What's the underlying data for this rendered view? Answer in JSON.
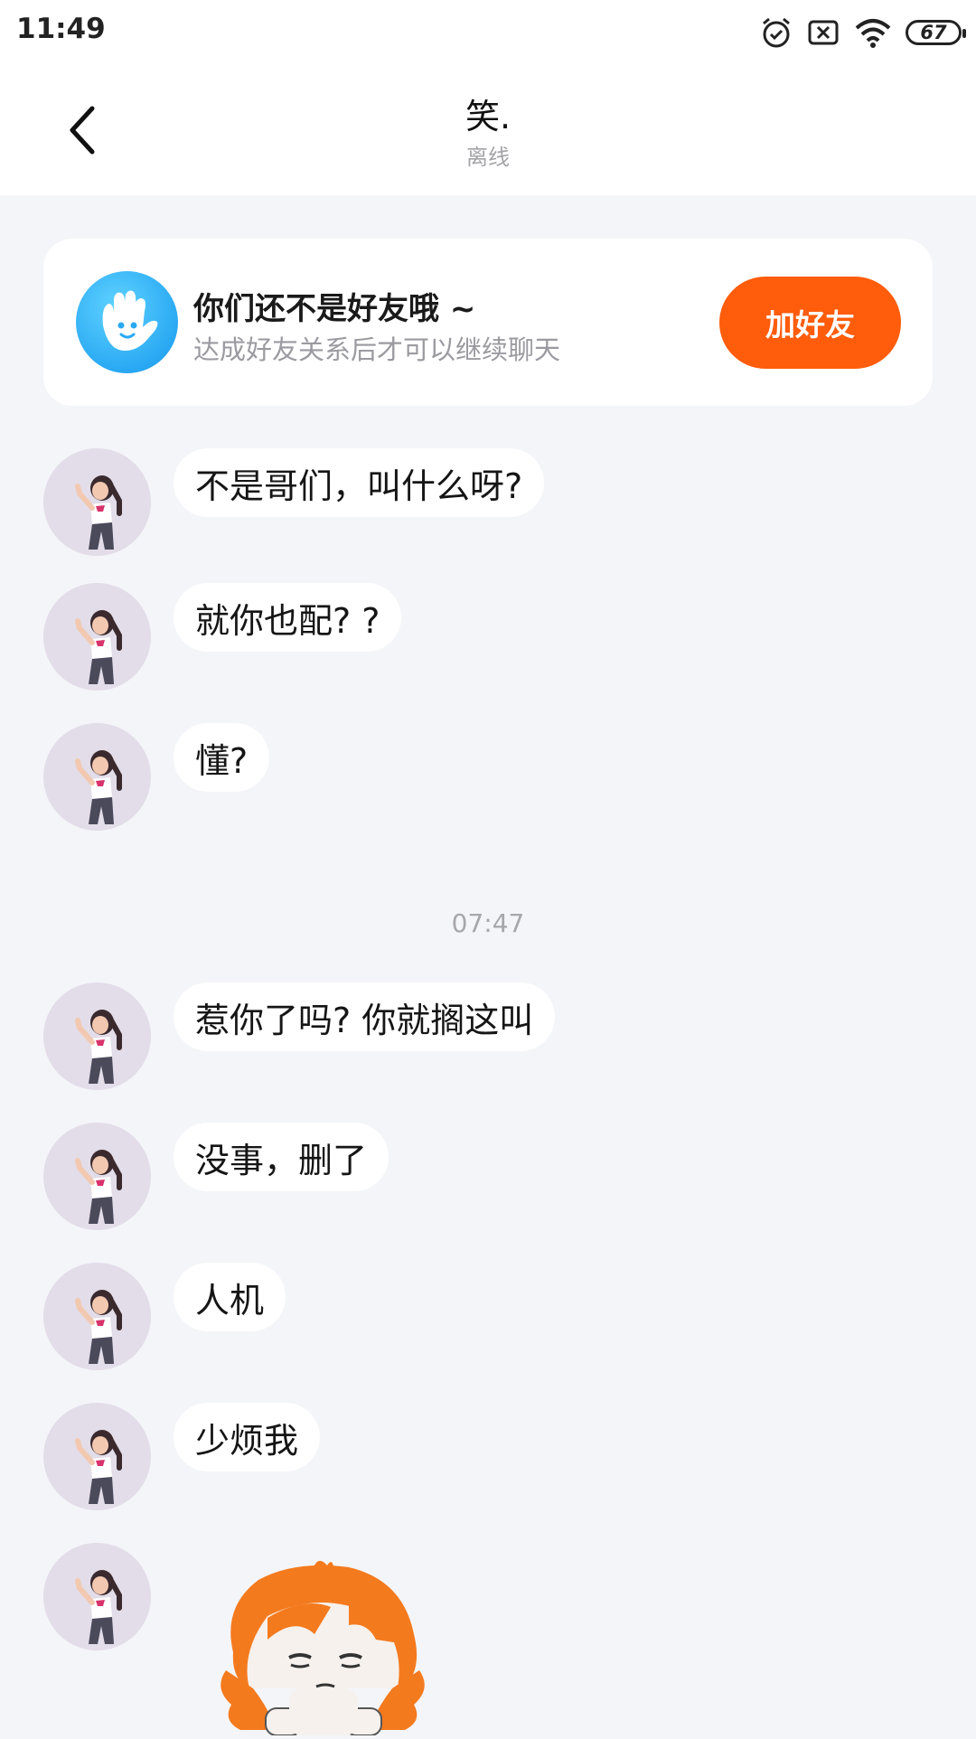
{
  "status_bar": {
    "time": "11:49",
    "battery": "67",
    "icons": [
      "alarm-icon",
      "sim-disabled-icon",
      "wifi-icon",
      "battery-icon"
    ]
  },
  "header": {
    "title": "笑.",
    "subtitle": "离线",
    "back_icon": "chevron-left-icon"
  },
  "banner": {
    "icon": "waving-hand-icon",
    "title": "你们还不是好友哦 ~",
    "description": "达成好友关系后才可以继续聊天",
    "button_label": "加好友",
    "button_color": "#ff5c0b"
  },
  "messages": [
    {
      "text": "不是哥们，叫什么呀?"
    },
    {
      "text": "就你也配? ?"
    },
    {
      "text": "懂?"
    },
    {
      "text": "惹你了吗? 你就搁这叫"
    },
    {
      "text": "没事，删了"
    },
    {
      "text": "人机"
    },
    {
      "text": "少烦我"
    }
  ],
  "timestamp": "07:47",
  "sticker": {
    "icon": "bored-anime-girl-sticker"
  }
}
